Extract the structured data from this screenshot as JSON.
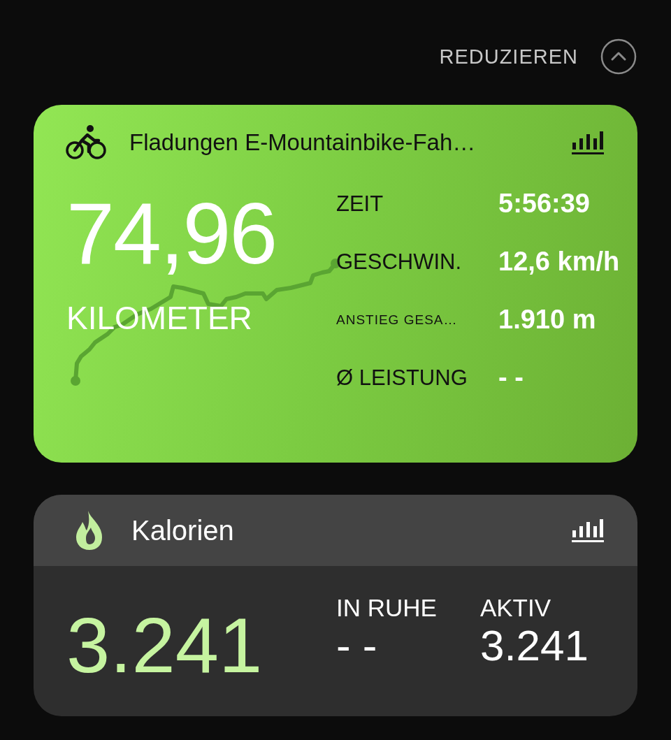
{
  "header": {
    "collapse_label": "REDUZIEREN"
  },
  "workout": {
    "title": "Fladungen E-Mountainbike-Fah…",
    "distance": "74,96",
    "distance_unit": "KILOMETER",
    "stats": [
      {
        "kind": "normal",
        "label": "ZEIT",
        "value": "5:56:39"
      },
      {
        "kind": "normal",
        "label": "GESCHWIN.",
        "value": "12,6 km/h"
      },
      {
        "kind": "small",
        "label": "ANSTIEG GESA…",
        "value": "1.910 m"
      },
      {
        "kind": "normal",
        "label": "Ø LEISTUNG",
        "value": "- -"
      }
    ]
  },
  "calories": {
    "title": "Kalorien",
    "total": "3.241",
    "breakdown": [
      {
        "label": "IN RUHE",
        "value": "- -"
      },
      {
        "label": "AKTIV",
        "value": "3.241"
      }
    ]
  }
}
